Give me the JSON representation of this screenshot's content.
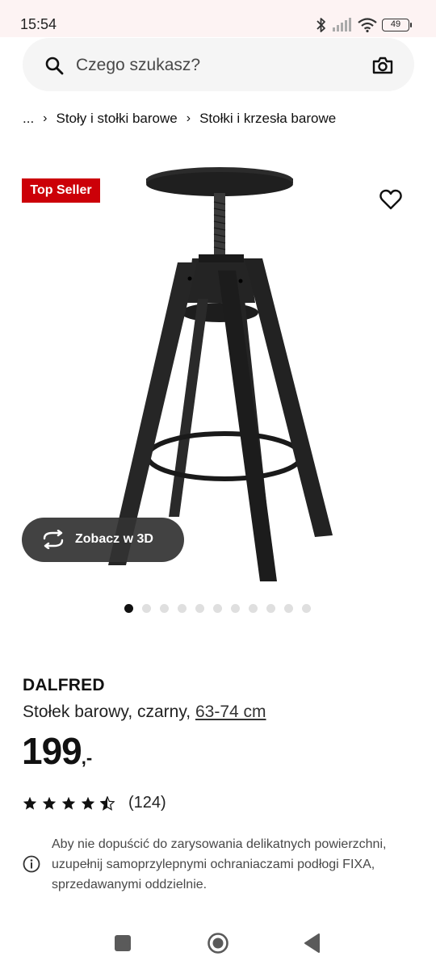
{
  "status_bar": {
    "time": "15:54",
    "battery": "49",
    "icons": [
      "bluetooth-icon",
      "signal-icon",
      "wifi-icon",
      "battery-icon"
    ]
  },
  "search": {
    "placeholder": "Czego szukasz?",
    "icons": [
      "search-icon",
      "camera-icon"
    ]
  },
  "breadcrumb": {
    "ellipsis": "...",
    "items": [
      "Stoły i stołki barowe",
      "Stołki i krzesła barowe"
    ]
  },
  "badge": {
    "label": "Top Seller",
    "color": "#cc0008"
  },
  "gallery": {
    "view_3d_label": "Zobacz w 3D",
    "total_images": 11,
    "active_index": 0
  },
  "product": {
    "name": "DALFRED",
    "description": "Stołek barowy, czarny,",
    "size": "63-74 cm",
    "price_main": "199",
    "price_suffix": ",-",
    "rating": 4.5,
    "rating_count": "(124)"
  },
  "info": {
    "text": "Aby nie dopuścić do zarysowania delikatnych powierzchni, uzupełnij samoprzylepnymi ochraniaczami podłogi FIXA, sprzedawanymi oddzielnie."
  },
  "colors": {
    "accent": "#cc0008",
    "text": "#111111",
    "search_bg": "#f5f5f5"
  }
}
